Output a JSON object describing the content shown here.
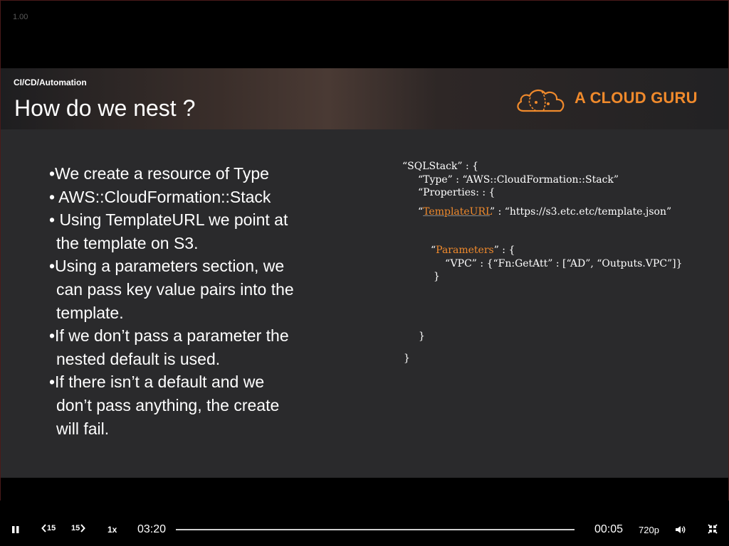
{
  "player": {
    "rate_overlay": "1.00",
    "playback_speed": "1x",
    "current_time": "03:20",
    "remaining_time": "00:05",
    "quality": "720p",
    "rewind_label": "15",
    "forward_label": "15",
    "progress_fraction": 0.0
  },
  "slide": {
    "category": "CI/CD/Automation",
    "title": "How do we nest ?",
    "logo_text": "A CLOUD GURU",
    "accent_color": "#f08a2c",
    "bullets": [
      "•We create a resource of Type",
      "• AWS::CloudFormation::Stack",
      "• Using TemplateURL we point at",
      "  the template on S3.",
      "•Using a parameters section, we",
      "  can pass key value pairs into the",
      "  template.",
      "•If we don’t pass a parameter the",
      "  nested default is used.",
      "•If there isn’t a default and we",
      "  don’t pass anything, the create",
      "  will fail."
    ],
    "code": {
      "l1": "“SQLStack” : {",
      "l2": "“Type” : “AWS::CloudFormation::Stack”",
      "l3": "“Properties: : {",
      "l4_key": "TemplateURL",
      "l4_open": "“",
      "l4_rest": "” : “https://s3.etc.etc/template.json”",
      "l5_key": "Parameters",
      "l5_open": "“",
      "l5_rest": "” : {",
      "l6": "“VPC” : {“Fn:GetAtt” : [“AD”, “Outputs.VPC”]}",
      "l7": "}",
      "l8": "}",
      "l9": "}"
    }
  }
}
